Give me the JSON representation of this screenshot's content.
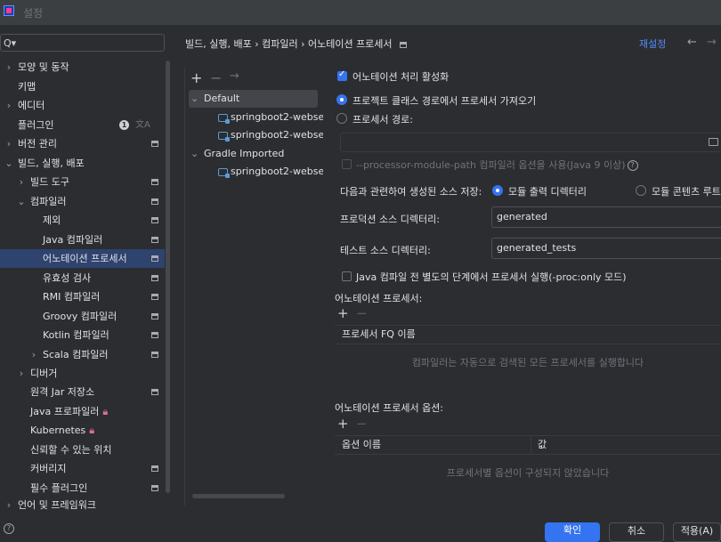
{
  "window": {
    "title": "설정"
  },
  "search": {
    "icon": "Q▾"
  },
  "sidebar": {
    "items": [
      {
        "label": "모양 및 동작",
        "arrow": "›"
      },
      {
        "label": "키맵",
        "arrow": ""
      },
      {
        "label": "에디터",
        "arrow": "›"
      },
      {
        "label": "플러그인",
        "arrow": "",
        "badge": "1"
      },
      {
        "label": "버전 관리",
        "arrow": "›"
      },
      {
        "label": "빌드, 실행, 배포",
        "arrow": "⌄"
      },
      {
        "label": "빌드 도구",
        "arrow": "›"
      },
      {
        "label": "컴파일러",
        "arrow": "⌄"
      },
      {
        "label": "제외",
        "arrow": ""
      },
      {
        "label": "Java 컴파일러",
        "arrow": ""
      },
      {
        "label": "어노테이션 프로세서",
        "arrow": ""
      },
      {
        "label": "유효성 검사",
        "arrow": ""
      },
      {
        "label": "RMI 컴파일러",
        "arrow": ""
      },
      {
        "label": "Groovy 컴파일러",
        "arrow": ""
      },
      {
        "label": "Kotlin 컴파일러",
        "arrow": ""
      },
      {
        "label": "Scala 컴파일러",
        "arrow": "›"
      },
      {
        "label": "디버거",
        "arrow": "›"
      },
      {
        "label": "원격 Jar 저장소",
        "arrow": ""
      },
      {
        "label": "Java 프로파일러",
        "arrow": ""
      },
      {
        "label": "Kubernetes",
        "arrow": ""
      },
      {
        "label": "신뢰할 수 있는 위치",
        "arrow": ""
      },
      {
        "label": "커버리지",
        "arrow": ""
      },
      {
        "label": "필수 플러그인",
        "arrow": ""
      },
      {
        "label": "언어 및 프레임워크",
        "arrow": "›"
      }
    ]
  },
  "header": {
    "breadcrumb": "빌드, 실행, 배포  ›  컴파일러  ›  어노테이션 프로세서",
    "reset": "재설정",
    "back": "←",
    "forward": "→"
  },
  "profiles": {
    "add": "+",
    "remove": "−",
    "move": "→",
    "default_label": "Default",
    "default_arrow": "⌄",
    "module1": "springboot2-webse",
    "module2": "springboot2-webse",
    "gradle_label": "Gradle Imported",
    "gradle_arrow": "⌄",
    "module3": "springboot2-webse"
  },
  "settings": {
    "enable_processing": "어노테이션 처리 활성화",
    "from_classpath": "프로젝트 클래스 경로에서 프로세서 가져오기",
    "processor_path": "프로세서 경로:",
    "module_path_option": "--processor-module-path 컴파일러 옵션을 사용(Java 9 이상)",
    "help": "?",
    "store_label": "다음과 관련하여 생성된 소스 저장:",
    "store_opt1": "모듈 출력 디렉터리",
    "store_opt2": "모듈 콘텐츠 루트",
    "prod_dir_label": "프로덕션 소스 디렉터리:",
    "prod_dir_value": "generated",
    "test_dir_label": "테스트 소스 디렉터리:",
    "test_dir_value": "generated_tests",
    "proc_only": "Java 컴파일 전 별도의 단계에서 프로세서 실행(-proc:only 모드)",
    "processors_label": "어노테이션 프로세서:",
    "processors_col": "프로세서 FQ 이름",
    "processors_empty": "컴파일러는 자동으로 검색된 모든 프로세서를 실행합니다",
    "options_label": "어노테이션 프로세서 옵션:",
    "options_col_name": "옵션 이름",
    "options_col_value": "값",
    "options_empty": "프로세서별 옵션이 구성되지 않았습니다",
    "add": "+",
    "remove": "−"
  },
  "footer": {
    "ok": "확인",
    "cancel": "취소",
    "apply": "적용(A)",
    "help": "?"
  }
}
